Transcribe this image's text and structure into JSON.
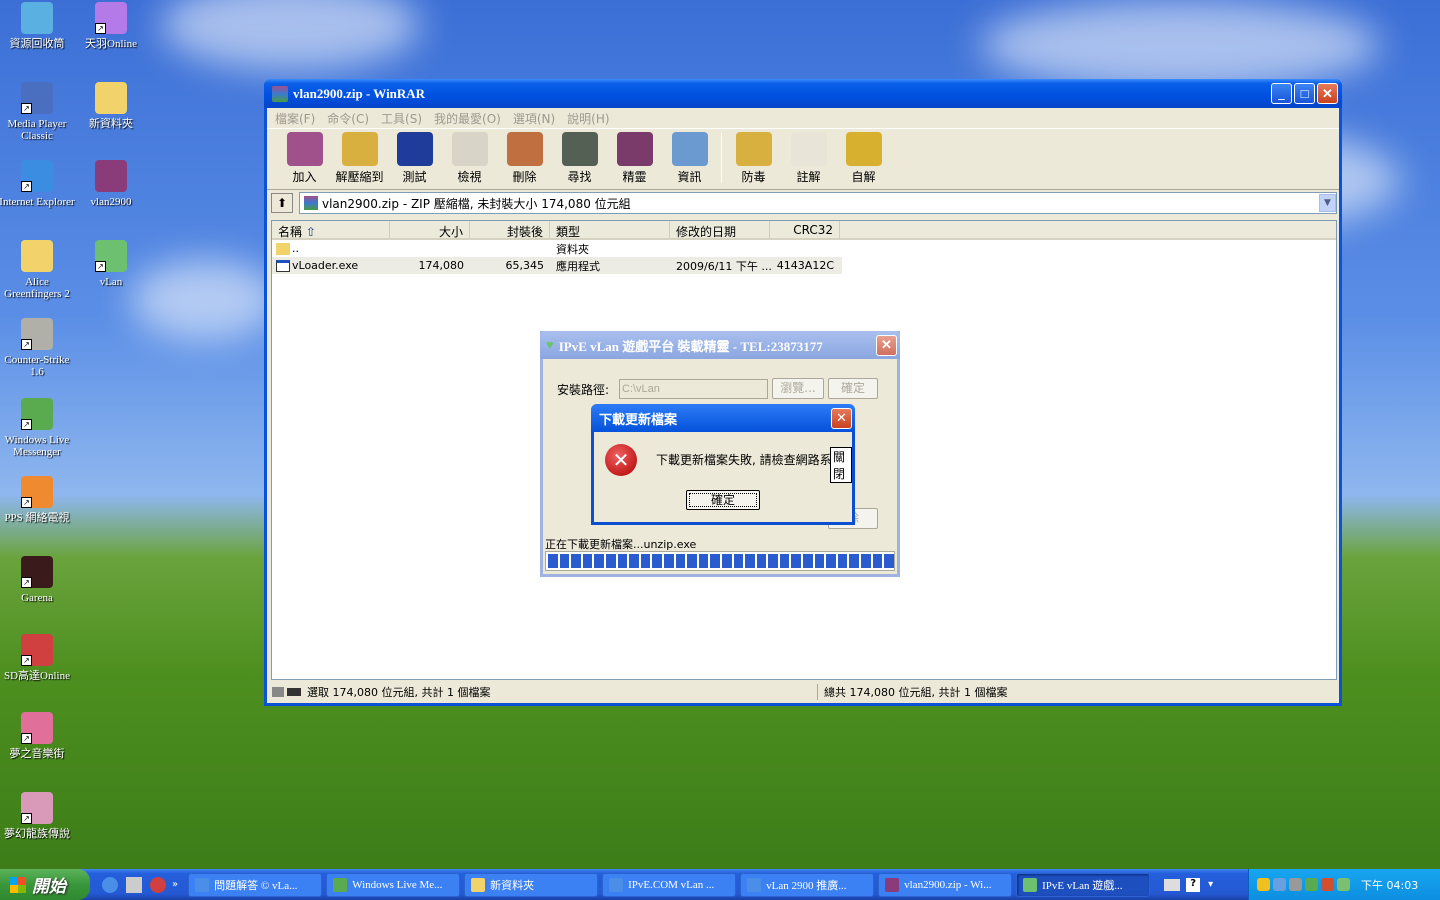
{
  "desktop": {
    "icons": [
      {
        "label": "資源回收筒",
        "col": 0,
        "row": 0,
        "color": "#5ab0e0",
        "shortcut": false
      },
      {
        "label": "天羽Online",
        "col": 1,
        "row": 0,
        "color": "#b47ae8",
        "shortcut": true
      },
      {
        "label": "Media Player Classic",
        "col": 0,
        "row": 1,
        "color": "#4a6fc0",
        "shortcut": true
      },
      {
        "label": "新資料夾",
        "col": 1,
        "row": 1,
        "color": "#f2d36b",
        "shortcut": false
      },
      {
        "label": "Internet Explorer",
        "col": 0,
        "row": 2,
        "color": "#3a8de0",
        "shortcut": true
      },
      {
        "label": "vlan2900",
        "col": 1,
        "row": 2,
        "color": "#8a3b7a",
        "shortcut": false
      },
      {
        "label": "Alice Greenfingers 2",
        "col": 0,
        "row": 3,
        "color": "#f2d36b",
        "shortcut": false
      },
      {
        "label": "vLan",
        "col": 1,
        "row": 3,
        "color": "#6cc070",
        "shortcut": true
      },
      {
        "label": "Counter-Strike 1.6",
        "col": 0,
        "row": 4,
        "color": "#b0b0a8",
        "shortcut": true
      },
      {
        "label": "Windows Live Messenger",
        "col": 0,
        "row": 5,
        "color": "#5aaa50",
        "shortcut": true
      },
      {
        "label": "PPS 網絡電視",
        "col": 0,
        "row": 6,
        "color": "#f08a30",
        "shortcut": true
      },
      {
        "label": "Garena",
        "col": 0,
        "row": 7,
        "color": "#3a1a1a",
        "shortcut": true
      },
      {
        "label": "SD高達Online",
        "col": 0,
        "row": 8,
        "color": "#d04040",
        "shortcut": true
      },
      {
        "label": "夢之音樂街",
        "col": 0,
        "row": 9,
        "color": "#e0709a",
        "shortcut": true
      },
      {
        "label": "夢幻龍族傳說",
        "col": 0,
        "row": 10,
        "color": "#d89ab8",
        "shortcut": true
      }
    ]
  },
  "winrar": {
    "title": "vlan2900.zip - WinRAR",
    "menu": [
      "檔案(F)",
      "命令(C)",
      "工具(S)",
      "我的最愛(O)",
      "選項(N)",
      "說明(H)"
    ],
    "toolbar": [
      {
        "label": "加入",
        "color": "#a0508a"
      },
      {
        "label": "解壓縮到",
        "color": "#d8b040"
      },
      {
        "label": "測試",
        "color": "#203c9a"
      },
      {
        "label": "檢視",
        "color": "#d8d4c8"
      },
      {
        "label": "刪除",
        "color": "#c07040"
      },
      {
        "label": "尋找",
        "color": "#556055"
      },
      {
        "label": "精靈",
        "color": "#7a3a6a"
      },
      {
        "label": "資訊",
        "color": "#6a9ad0"
      },
      {
        "label": "防毒",
        "color": "#d8b040"
      },
      {
        "label": "註解",
        "color": "#e8e4d8"
      },
      {
        "label": "自解",
        "color": "#d8b030"
      }
    ],
    "address": "vlan2900.zip - ZIP 壓縮檔, 未封裝大小 174,080 位元組",
    "columns": [
      "名稱",
      "大小",
      "封裝後",
      "類型",
      "修改的日期",
      "CRC32"
    ],
    "rows": [
      {
        "name": "..",
        "size": "",
        "packed": "",
        "type": "資料夾",
        "modified": "",
        "crc": ""
      },
      {
        "name": "vLoader.exe",
        "size": "174,080",
        "packed": "65,345",
        "type": "應用程式",
        "modified": "2009/6/11 下午 ...",
        "crc": "4143A12C"
      }
    ],
    "status_left": "選取 174,080 位元組, 共計 1 個檔案",
    "status_right": "總共 174,080 位元組, 共計 1 個檔案"
  },
  "installer": {
    "title": "IPvE vLan 遊戲平台 裝載精靈 - TEL:23873177",
    "path_label": "安裝路徑:",
    "path_value": "C:\\vLan",
    "browse_label": "瀏覽...",
    "ok_label": "確定",
    "hidden_button_fragment": "除",
    "progress_text": "正在下載更新檔案...unzip.exe",
    "progress": 1.0
  },
  "error_dialog": {
    "title": "下載更新檔案",
    "message": "下載更新檔案失敗, 請檢查網路系",
    "tooltip": "關閉",
    "ok_label": "確定"
  },
  "taskbar": {
    "start_label": "開始",
    "tasks": [
      {
        "label": "問題解答 © vLa...",
        "active": false,
        "color": "#4a8ee8"
      },
      {
        "label": "Windows Live Me...",
        "active": false,
        "color": "#5aaa50"
      },
      {
        "label": "新資料夾",
        "active": false,
        "color": "#f2d36b"
      },
      {
        "label": "IPvE.COM vLan ...",
        "active": false,
        "color": "#4a8ee8"
      },
      {
        "label": "vLan 2900 推廣...",
        "active": false,
        "color": "#4a8ee8"
      },
      {
        "label": "vlan2900.zip - Wi...",
        "active": false,
        "color": "#8a3b7a"
      },
      {
        "label": "IPvE vLan 遊戲...",
        "active": true,
        "color": "#6cc070"
      }
    ],
    "clock": "下午 04:03"
  }
}
